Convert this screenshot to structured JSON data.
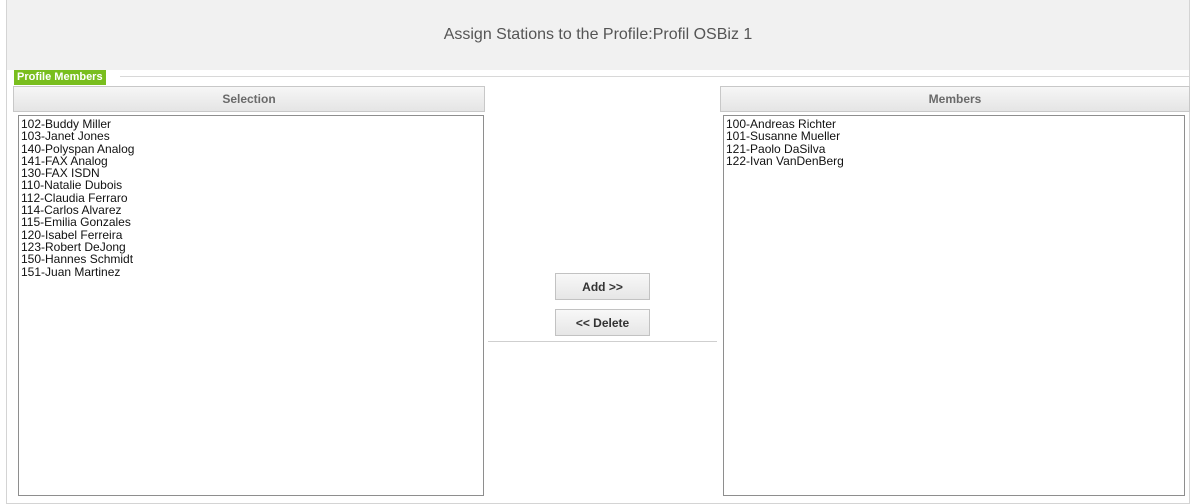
{
  "header": {
    "title": "Assign Stations to the Profile:Profil OSBiz 1"
  },
  "section": {
    "label": "Profile Members"
  },
  "selection": {
    "header": "Selection",
    "items": [
      "102-Buddy Miller",
      "103-Janet Jones",
      "140-Polyspan Analog",
      "141-FAX Analog",
      "130-FAX ISDN",
      "110-Natalie Dubois",
      "112-Claudia Ferraro",
      "114-Carlos Alvarez",
      "115-Emilia Gonzales",
      "120-Isabel Ferreira",
      "123-Robert DeJong",
      "150-Hannes Schmidt",
      "151-Juan Martinez"
    ]
  },
  "members": {
    "header": "Members",
    "items": [
      "100-Andreas Richter",
      "101-Susanne Mueller",
      "121-Paolo DaSilva",
      "122-Ivan VanDenBerg"
    ]
  },
  "actions": {
    "add_label": "Add >>",
    "delete_label": "<< Delete"
  }
}
